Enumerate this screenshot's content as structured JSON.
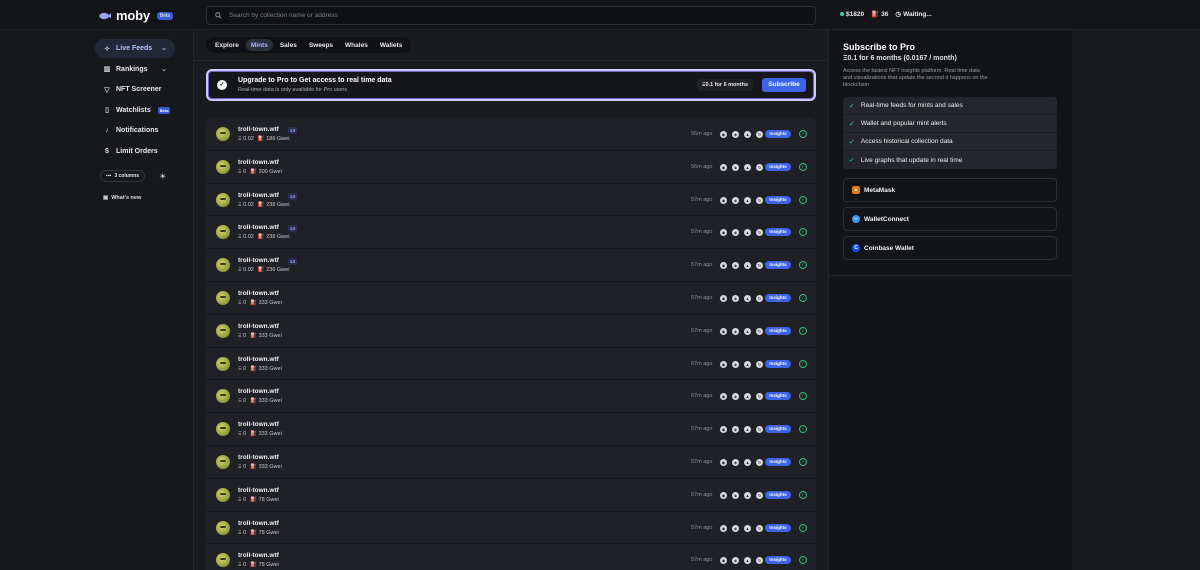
{
  "app": {
    "name": "moby",
    "badge": "Beta"
  },
  "search": {
    "placeholder": "Search by collection name or address"
  },
  "stats": {
    "eth_price": "$1820",
    "gas": "36",
    "status": "Waiting..."
  },
  "sidebar": {
    "items": [
      {
        "label": "Live Feeds",
        "icon": "pulse-icon"
      },
      {
        "label": "Rankings",
        "icon": "bar-chart-icon"
      },
      {
        "label": "NFT Screener",
        "icon": "filter-icon"
      },
      {
        "label": "Watchlists",
        "icon": "bookmark-icon",
        "badge": "Beta"
      },
      {
        "label": "Notifications",
        "icon": "bell-icon"
      },
      {
        "label": "Limit Orders",
        "icon": "dollar-icon"
      }
    ],
    "columns_label": "3 columns",
    "whats_new": "What's new"
  },
  "tabs": [
    {
      "label": "Explore"
    },
    {
      "label": "Mints"
    },
    {
      "label": "Sales"
    },
    {
      "label": "Sweeps"
    },
    {
      "label": "Whales"
    },
    {
      "label": "Wallets"
    }
  ],
  "banner": {
    "title": "Upgrade to Pro to Get access to real time data",
    "subtitle": "Real-time data is only available for Pro users",
    "price": "Ξ0.1 for 6 months",
    "button": "Subscribe"
  },
  "feed": {
    "insights_label": "Insights",
    "rows": [
      {
        "name": "troll-town.wtf",
        "badge": "x3",
        "price": "Ξ 0.02",
        "gas": "186 Gwei",
        "time": "56m ago"
      },
      {
        "name": "troll-town.wtf",
        "badge": "",
        "price": "Ξ 0",
        "gas": "200 Gwei",
        "time": "56m ago"
      },
      {
        "name": "troll-town.wtf",
        "badge": "x3",
        "price": "Ξ 0.02",
        "gas": "238 Gwei",
        "time": "57m ago"
      },
      {
        "name": "troll-town.wtf",
        "badge": "x3",
        "price": "Ξ 0.02",
        "gas": "238 Gwei",
        "time": "57m ago"
      },
      {
        "name": "troll-town.wtf",
        "badge": "x3",
        "price": "Ξ 0.02",
        "gas": "236 Gwei",
        "time": "57m ago"
      },
      {
        "name": "troll-town.wtf",
        "badge": "",
        "price": "Ξ 0",
        "gas": "333 Gwei",
        "time": "57m ago"
      },
      {
        "name": "troll-town.wtf",
        "badge": "",
        "price": "Ξ 0",
        "gas": "333 Gwei",
        "time": "57m ago"
      },
      {
        "name": "troll-town.wtf",
        "badge": "",
        "price": "Ξ 0",
        "gas": "333 Gwei",
        "time": "57m ago"
      },
      {
        "name": "troll-town.wtf",
        "badge": "",
        "price": "Ξ 0",
        "gas": "333 Gwei",
        "time": "57m ago"
      },
      {
        "name": "troll-town.wtf",
        "badge": "",
        "price": "Ξ 0",
        "gas": "333 Gwei",
        "time": "57m ago"
      },
      {
        "name": "troll-town.wtf",
        "badge": "",
        "price": "Ξ 0",
        "gas": "333 Gwei",
        "time": "57m ago"
      },
      {
        "name": "troll-town.wtf",
        "badge": "",
        "price": "Ξ 0",
        "gas": "78 Gwei",
        "time": "57m ago"
      },
      {
        "name": "troll-town.wtf",
        "badge": "",
        "price": "Ξ 0",
        "gas": "78 Gwei",
        "time": "57m ago"
      },
      {
        "name": "troll-town.wtf",
        "badge": "",
        "price": "Ξ 0",
        "gas": "78 Gwei",
        "time": "57m ago"
      }
    ]
  },
  "pro": {
    "title": "Subscribe to Pro",
    "price": "Ξ0.1 for 6 months (0.0167 / month)",
    "description": "Access the fastest NFT insights platform. Real time data and visualizations that update the second it happens on the blockchain",
    "features": [
      "Real-time feeds for mints and sales",
      "Wallet and popular mint alerts",
      "Access historical collection data",
      "Live graphs that update in real time"
    ],
    "wallets": [
      {
        "label": "MetaMask",
        "icon": "metamask-icon",
        "color": "#e2761b"
      },
      {
        "label": "WalletConnect",
        "icon": "walletconnect-icon",
        "color": "#3b99fc"
      },
      {
        "label": "Coinbase Wallet",
        "icon": "coinbase-icon",
        "color": "#1652f0"
      }
    ]
  }
}
